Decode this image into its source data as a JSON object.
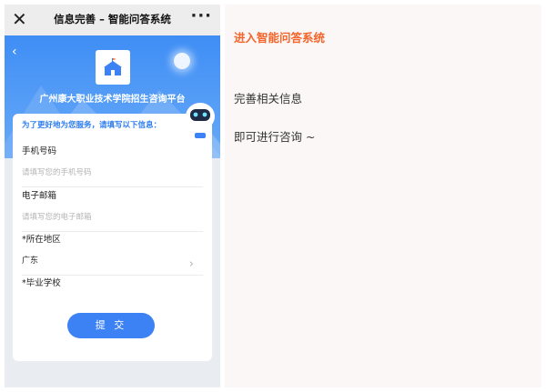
{
  "titlebar": {
    "close_glyph": "✕",
    "title": "信息完善 – 智能问答系统",
    "more_glyph": "···"
  },
  "hero": {
    "back_glyph": "‹",
    "org_name": "广州康大职业技术学院招生咨询平台"
  },
  "form": {
    "notice": "为了更好地为您服务，请填写以下信息：",
    "fields": [
      {
        "label": "手机号码",
        "placeholder": "请填写您的手机号码"
      },
      {
        "label": "电子邮箱",
        "placeholder": "请填写您的电子邮箱"
      },
      {
        "label": "*所在地区",
        "value": "广东",
        "chevron": "›"
      },
      {
        "label": "*毕业学校"
      }
    ],
    "submit_label": "提 交"
  },
  "caption": {
    "heading": "进入智能问答系统",
    "line1": "完善相关信息",
    "line2": "即可进行咨询 ~"
  },
  "colors": {
    "primary": "#3d82f5",
    "accent": "#f3652b",
    "hero": "#4b96f5"
  },
  "icons": [
    "close-icon",
    "more-icon",
    "back-icon",
    "school-logo-icon",
    "moon-icon",
    "robot-mascot-icon",
    "chevron-right-icon"
  ]
}
